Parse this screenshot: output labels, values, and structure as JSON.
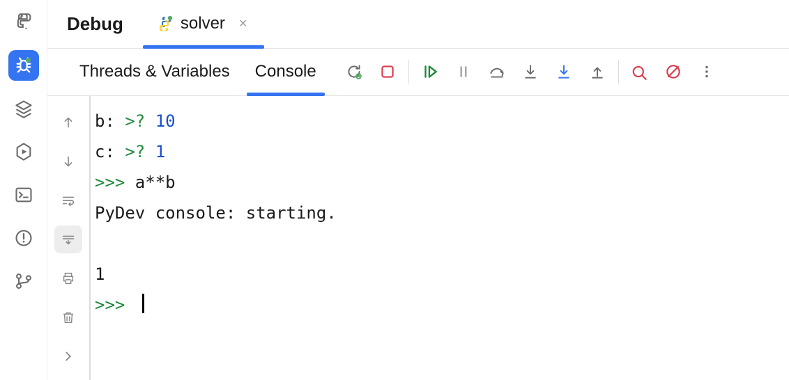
{
  "top": {
    "debug_label": "Debug",
    "file_tab": {
      "name": "solver",
      "close_glyph": "×"
    }
  },
  "subtabs": {
    "threads": "Threads & Variables",
    "console": "Console"
  },
  "sidebar_icons": {
    "python": "python-icon",
    "debug": "bug-icon",
    "layers": "layers-icon",
    "services": "hex-play-icon",
    "terminal": "terminal-icon",
    "problems": "problems-icon",
    "vcs": "git-branch-icon"
  },
  "toolbar": {
    "rerun": "rerun-icon",
    "stop": "stop-icon",
    "resume": "resume-icon",
    "pause": "pause-icon",
    "step_over": "step-over-icon",
    "step_into": "step-into-icon",
    "step_into_my": "step-into-my-icon",
    "step_out": "step-out-icon",
    "evaluate": "evaluate-icon",
    "reset": "reset-icon",
    "more": "more-icon"
  },
  "gutter": {
    "up": "scroll-up-icon",
    "down": "scroll-down-icon",
    "wrap": "soft-wrap-icon",
    "scroll_end": "scroll-to-end-icon",
    "print": "print-icon",
    "trash": "trash-icon",
    "expand": "expand-icon"
  },
  "console_lines": {
    "l1_prefix": "b: ",
    "l1_prompt": ">? ",
    "l1_val": "10",
    "l2_prefix": "c: ",
    "l2_prompt": ">? ",
    "l2_val": "1",
    "l3_prompt": ">>> ",
    "l3_expr": "a**b",
    "l4": "PyDev console: starting.",
    "l5": "",
    "l6": "1",
    "l7_prompt": ">>> "
  }
}
